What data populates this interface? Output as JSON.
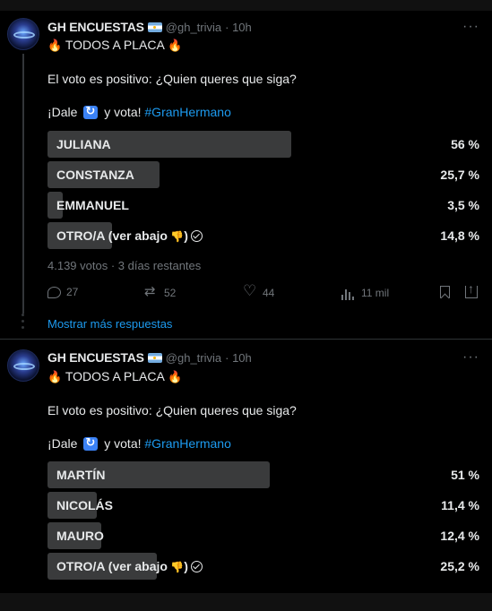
{
  "tweets": [
    {
      "author": "GH ENCUESTAS",
      "handle": "@gh_trivia",
      "time": "· 10h",
      "more": "···",
      "title_text": "TODOS A PLACA",
      "question": "El voto es positivo: ¿Quien queres que siga?",
      "cta_prefix": "¡Dale",
      "cta_middle": "y vota!",
      "hashtag": "#GranHermano",
      "options": [
        {
          "label": "JULIANA",
          "percent_text": "56 %",
          "fill": 0.56
        },
        {
          "label": "CONSTANZA",
          "percent_text": "25,7 %",
          "fill": 0.257
        },
        {
          "label": "EMMANUEL",
          "percent_text": "3,5 %",
          "fill": 0.035
        },
        {
          "label": "OTRO/A (ver abajo",
          "label_suffix": ")",
          "percent_text": "14,8 %",
          "fill": 0.148
        }
      ],
      "meta": "4.139 votos · 3 días restantes",
      "actions": {
        "replies": "27",
        "retweets": "52",
        "likes": "44",
        "views": "11 mil"
      }
    },
    {
      "author": "GH ENCUESTAS",
      "handle": "@gh_trivia",
      "time": "· 10h",
      "more": "···",
      "title_text": "TODOS A PLACA",
      "question": "El voto es positivo: ¿Quien queres que siga?",
      "cta_prefix": "¡Dale",
      "cta_middle": "y vota!",
      "hashtag": "#GranHermano",
      "options": [
        {
          "label": "MARTÍN",
          "percent_text": "51 %",
          "fill": 0.51
        },
        {
          "label": "NICOLÁS",
          "percent_text": "11,4 %",
          "fill": 0.114
        },
        {
          "label": "MAURO",
          "percent_text": "12,4 %",
          "fill": 0.124
        },
        {
          "label": "OTRO/A (ver abajo",
          "label_suffix": ")",
          "percent_text": "25,2 %",
          "fill": 0.252
        }
      ]
    }
  ],
  "show_more": "Mostrar más respuestas",
  "colors": {
    "accent": "#1d9bf0",
    "bar": "#3a3b3c",
    "muted": "#71767b",
    "text": "#e7e9ea"
  },
  "icons": {
    "reply": "reply-icon",
    "retweet": "retweet-icon",
    "like": "heart-icon",
    "views": "views-icon",
    "bookmark": "bookmark-icon",
    "share": "share-icon"
  }
}
